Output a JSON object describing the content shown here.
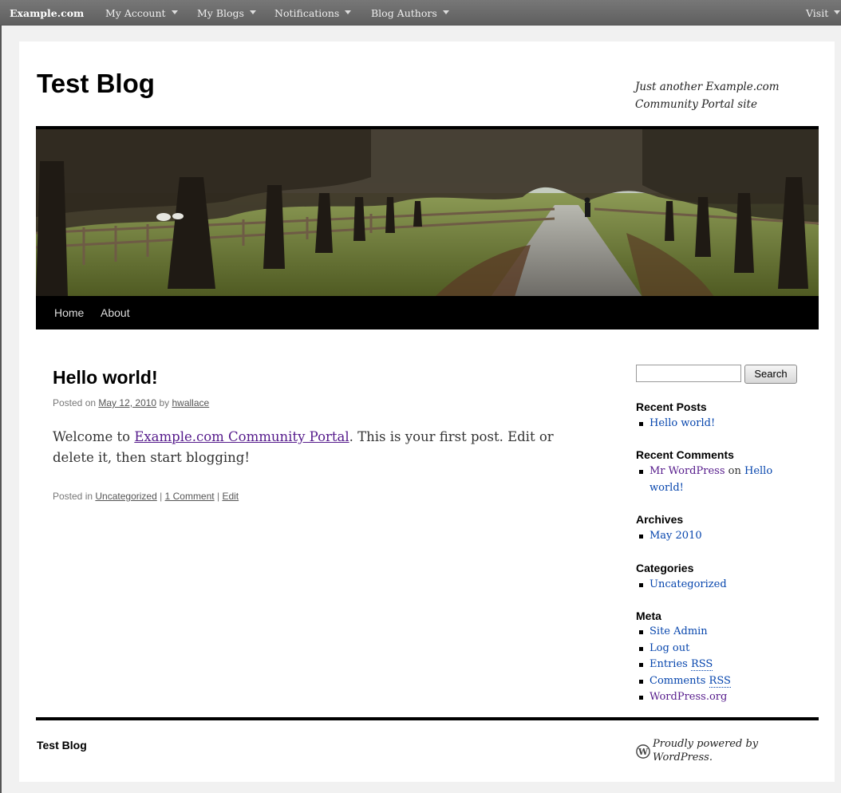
{
  "adminbar": {
    "site": "Example.com",
    "menus": [
      "My Account",
      "My Blogs",
      "Notifications",
      "Blog Authors"
    ],
    "visit": "Visit"
  },
  "site": {
    "title": "Test Blog",
    "description": "Just another Example.com Community Portal site"
  },
  "nav": [
    "Home",
    "About"
  ],
  "post": {
    "title": "Hello world!",
    "posted_on": "Posted on",
    "date": "May 12, 2010",
    "by": "by",
    "author": "hwallace",
    "body_pre": "Welcome to",
    "body_link": "Example.com Community Portal",
    "body_post": ". This is your first post. Edit or delete it, then start blogging!",
    "posted_in": "Posted in",
    "category": "Uncategorized",
    "sep": "|",
    "comments": "1 Comment",
    "edit": "Edit"
  },
  "sidebar": {
    "search_button": "Search",
    "recent_posts": {
      "title": "Recent Posts",
      "items": [
        "Hello world!"
      ]
    },
    "recent_comments": {
      "title": "Recent Comments",
      "author": "Mr WordPress",
      "on": "on",
      "post": "Hello world!"
    },
    "archives": {
      "title": "Archives",
      "items": [
        "May 2010"
      ]
    },
    "categories": {
      "title": "Categories",
      "items": [
        "Uncategorized"
      ]
    },
    "meta": {
      "title": "Meta",
      "site_admin": "Site Admin",
      "log_out": "Log out",
      "entries": "Entries",
      "comments": "Comments",
      "rss": "RSS",
      "wordpress": "WordPress.org"
    }
  },
  "footer": {
    "title": "Test Blog",
    "powered": "Proudly powered by WordPress."
  }
}
